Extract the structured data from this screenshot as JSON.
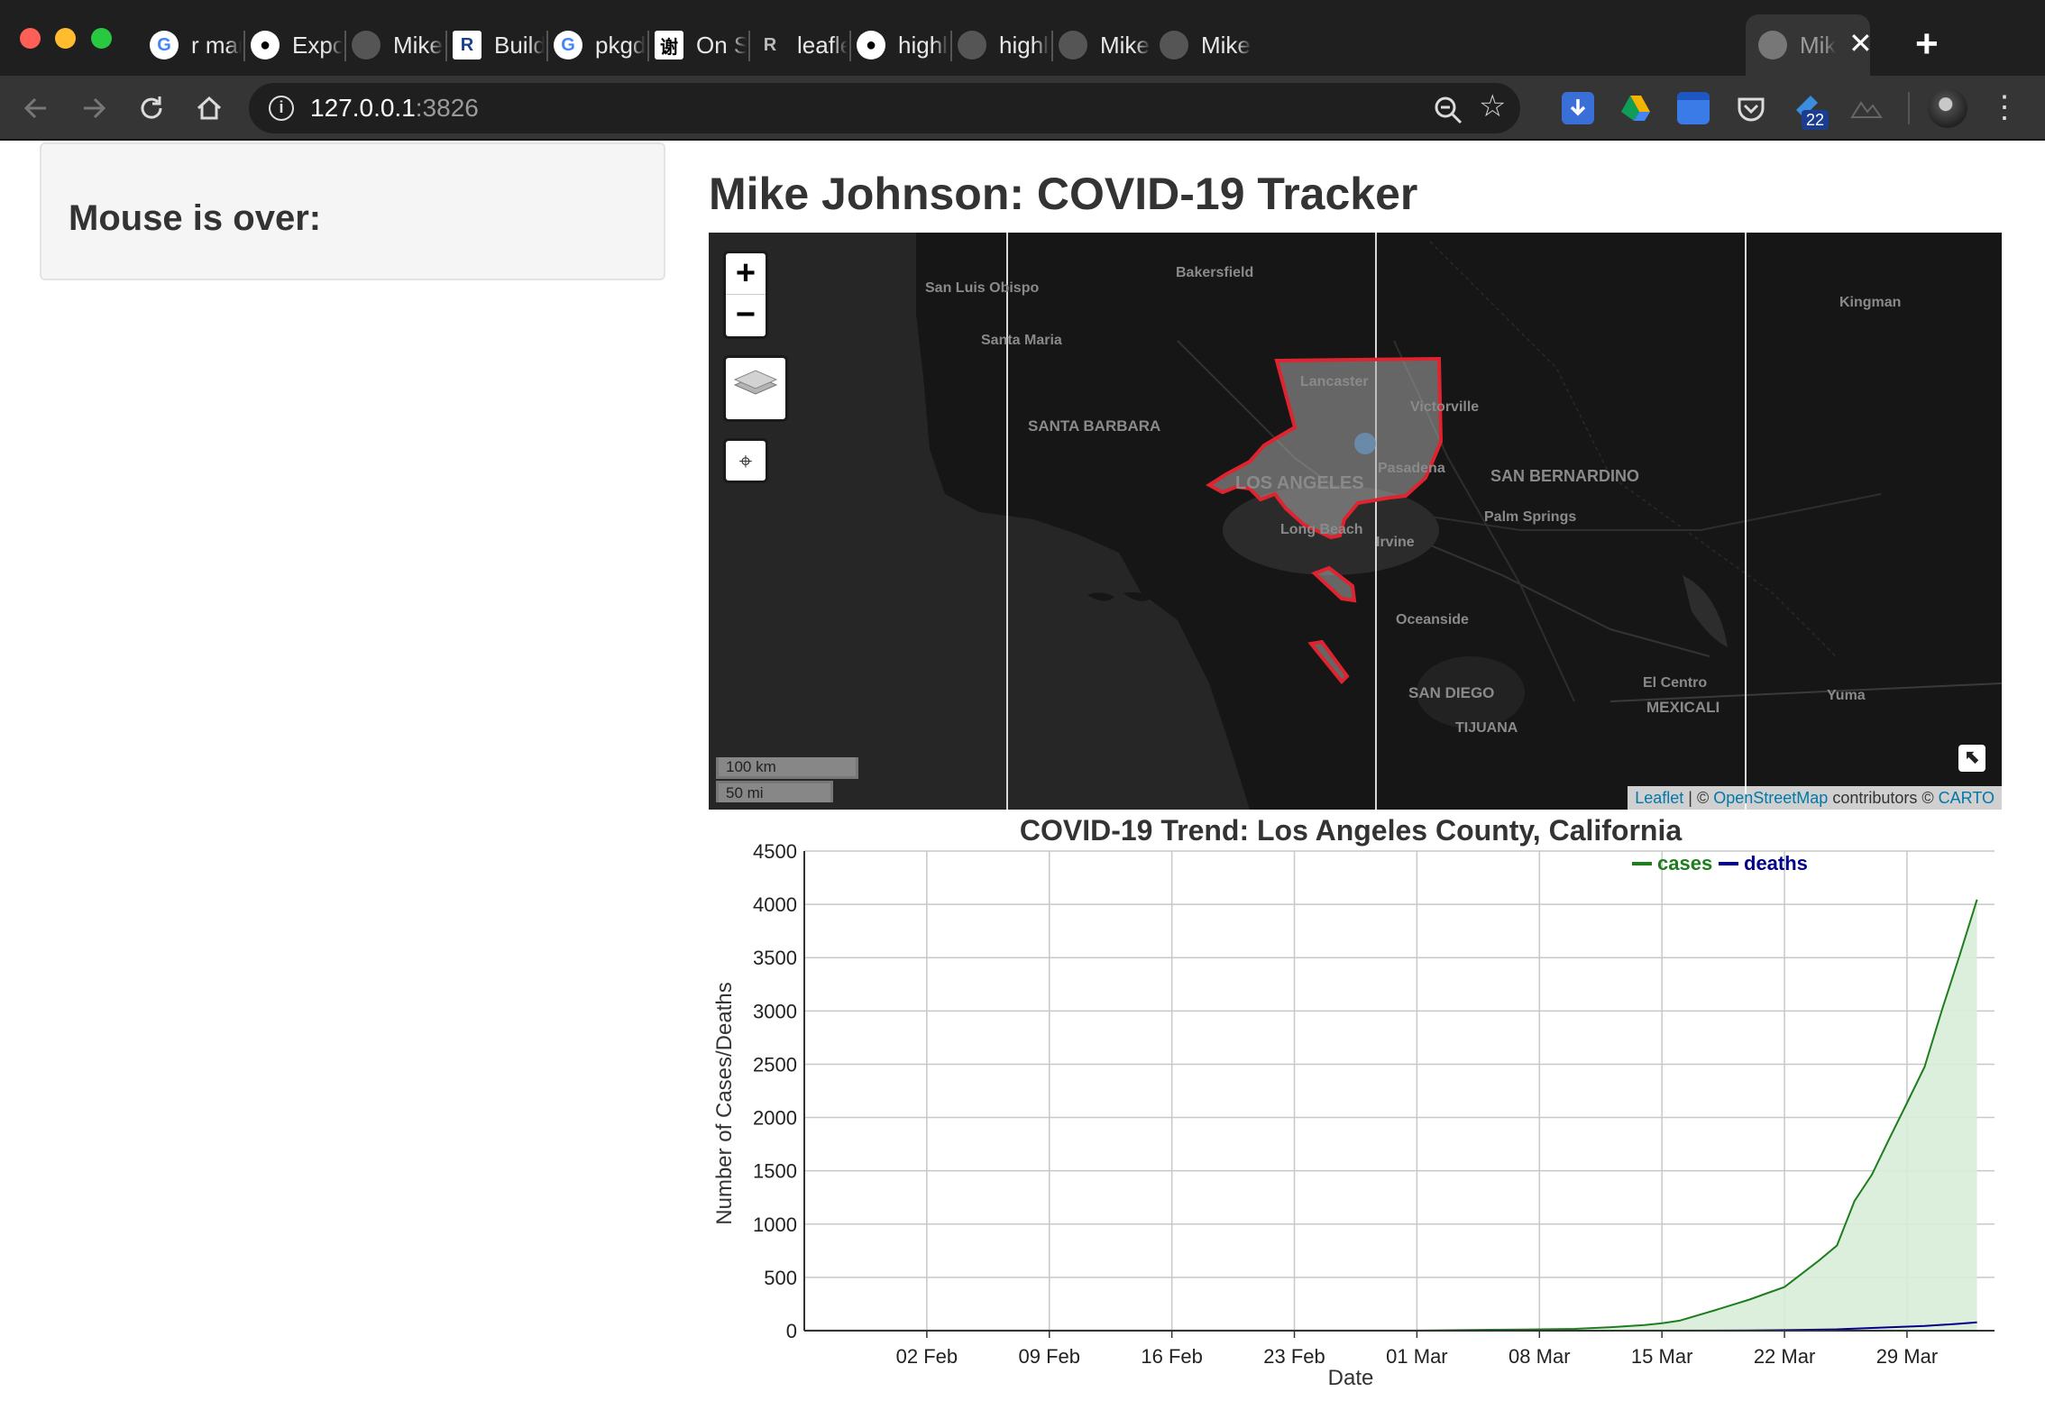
{
  "browser": {
    "tabs": [
      {
        "title": "r markd",
        "icon": "google-icon"
      },
      {
        "title": "Export :",
        "icon": "github-icon"
      },
      {
        "title": "Mike Jo",
        "icon": "globe-icon"
      },
      {
        "title": "Building",
        "icon": "r-package-icon"
      },
      {
        "title": "pkgdow",
        "icon": "google-icon"
      },
      {
        "title": "On Synt",
        "icon": "chinese-char-icon"
      },
      {
        "title": "leafletP",
        "icon": "r-logo-icon"
      },
      {
        "title": "highligh",
        "icon": "github-icon"
      },
      {
        "title": "highligh",
        "icon": "globe-icon"
      },
      {
        "title": "Mike Jo",
        "icon": "globe-icon"
      },
      {
        "title": "Mike Jo",
        "icon": "globe-icon"
      }
    ],
    "active_tab": {
      "title": "Mik",
      "icon": "globe-icon"
    },
    "tab_close": "✕",
    "new_tab": "+",
    "url_host": "127.0.0.1",
    "url_port": ":3826",
    "extension_badge": "22"
  },
  "sidebar": {
    "mouse_label": "Mouse is over:"
  },
  "page": {
    "title": "Mike Johnson: COVID-19 Tracker"
  },
  "map": {
    "zoom_in": "+",
    "zoom_out": "−",
    "scale_km": "100 km",
    "scale_mi": "50 mi",
    "attribution": {
      "leaflet": "Leaflet",
      "sep1": " | © ",
      "osm": "OpenStreetMap",
      "contributors": " contributors © ",
      "carto": "CARTO"
    },
    "highlight_color": "#e0242f",
    "place_labels": {
      "bakersfield": "Bakersfield",
      "san_luis_obispo": "San Luis Obispo",
      "santa_maria": "Santa Maria",
      "santa_barbara": "SANTA BARBARA",
      "lancaster": "Lancaster",
      "victorville": "Victorville",
      "pasadena": "Pasadena",
      "los_angeles": "LOS ANGELES",
      "san_bernardino": "SAN BERNARDINO",
      "long_beach": "Long Beach",
      "irvine": "Irvine",
      "palm_springs": "Palm Springs",
      "oceanside": "Oceanside",
      "san_diego": "SAN DIEGO",
      "tijuana": "TIJUANA",
      "el_centro": "El Centro",
      "mexicali": "MEXICALI",
      "yuma": "Yuma",
      "kingman": "Kingman"
    }
  },
  "chart_data": {
    "type": "area",
    "title": "COVID-19 Trend: Los Angeles County, California",
    "xlabel": "Date",
    "ylabel": "Number of Cases/Deaths",
    "xlim": [
      "2020-01-26",
      "2020-04-03"
    ],
    "ylim": [
      0,
      4500
    ],
    "yticks": [
      0,
      500,
      1000,
      1500,
      2000,
      2500,
      3000,
      3500,
      4000,
      4500
    ],
    "xticks": [
      {
        "date": "2020-02-02",
        "label": "02 Feb"
      },
      {
        "date": "2020-02-09",
        "label": "09 Feb"
      },
      {
        "date": "2020-02-16",
        "label": "16 Feb"
      },
      {
        "date": "2020-02-23",
        "label": "23 Feb"
      },
      {
        "date": "2020-03-01",
        "label": "01 Mar"
      },
      {
        "date": "2020-03-08",
        "label": "08 Mar"
      },
      {
        "date": "2020-03-15",
        "label": "15 Mar"
      },
      {
        "date": "2020-03-22",
        "label": "22 Mar"
      },
      {
        "date": "2020-03-29",
        "label": "29 Mar"
      }
    ],
    "grid": true,
    "legend_position": "top-right",
    "series": [
      {
        "name": "cases",
        "color": "#1e7e1e",
        "fill": "#d8ecd8",
        "points": [
          [
            "2020-01-26",
            1
          ],
          [
            "2020-02-02",
            1
          ],
          [
            "2020-02-09",
            1
          ],
          [
            "2020-02-16",
            1
          ],
          [
            "2020-02-23",
            1
          ],
          [
            "2020-03-01",
            1
          ],
          [
            "2020-03-04",
            7
          ],
          [
            "2020-03-07",
            11
          ],
          [
            "2020-03-10",
            17
          ],
          [
            "2020-03-12",
            32
          ],
          [
            "2020-03-14",
            53
          ],
          [
            "2020-03-15",
            69
          ],
          [
            "2020-03-16",
            94
          ],
          [
            "2020-03-18",
            190
          ],
          [
            "2020-03-20",
            292
          ],
          [
            "2020-03-21",
            351
          ],
          [
            "2020-03-22",
            409
          ],
          [
            "2020-03-24",
            662
          ],
          [
            "2020-03-25",
            799
          ],
          [
            "2020-03-26",
            1216
          ],
          [
            "2020-03-27",
            1465
          ],
          [
            "2020-03-28",
            1804
          ],
          [
            "2020-03-29",
            2136
          ],
          [
            "2020-03-30",
            2474
          ],
          [
            "2020-03-31",
            3011
          ],
          [
            "2020-04-01",
            3518
          ],
          [
            "2020-04-02",
            4045
          ]
        ]
      },
      {
        "name": "deaths",
        "color": "#00008b",
        "points": [
          [
            "2020-01-26",
            0
          ],
          [
            "2020-03-10",
            0
          ],
          [
            "2020-03-20",
            2
          ],
          [
            "2020-03-22",
            5
          ],
          [
            "2020-03-25",
            13
          ],
          [
            "2020-03-28",
            32
          ],
          [
            "2020-03-30",
            44
          ],
          [
            "2020-04-01",
            65
          ],
          [
            "2020-04-02",
            78
          ]
        ]
      }
    ]
  }
}
